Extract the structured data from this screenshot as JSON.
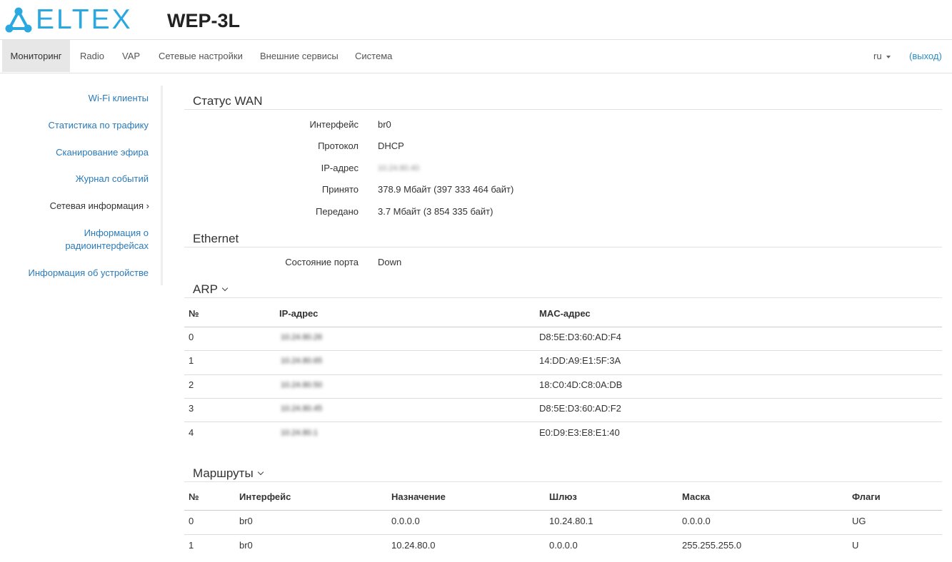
{
  "brand": {
    "logo_text": "ELTEX",
    "model": "WEP-3L",
    "accent_color": "#29a9e0"
  },
  "nav": {
    "items": [
      "Мониторинг",
      "Radio",
      "VAP",
      "Сетевые настройки",
      "Внешние сервисы",
      "Система"
    ],
    "active": "Мониторинг",
    "language": "ru",
    "logout": "(выход)"
  },
  "sidebar": {
    "items": [
      "Wi-Fi клиенты",
      "Статистика по трафику",
      "Сканирование эфира",
      "Журнал событий",
      "Сетевая информация ›",
      "Информация о",
      "радиоинтерфейсах",
      "Информация об устройстве"
    ],
    "current": "Сетевая информация ›"
  },
  "wan": {
    "title": "Статус WAN",
    "rows": [
      {
        "label": "Интерфейс",
        "value": "br0"
      },
      {
        "label": "Протокол",
        "value": "DHCP"
      },
      {
        "label": "IP-адрес",
        "value": "10.24.80.40"
      },
      {
        "label": "Принято",
        "value": "378.9 Мбайт (397 333 464 байт)"
      },
      {
        "label": "Передано",
        "value": "3.7 Мбайт (3 854 335 байт)"
      }
    ]
  },
  "ethernet": {
    "title": "Ethernet",
    "rows": [
      {
        "label": "Состояние порта",
        "value": "Down"
      }
    ]
  },
  "arp": {
    "title": "ARP",
    "headers": [
      "№",
      "IP-адрес",
      "MAC-адрес"
    ],
    "rows": [
      [
        "0",
        "10.24.80.26",
        "D8:5E:D3:60:AD:F4"
      ],
      [
        "1",
        "10.24.80.65",
        "14:DD:A9:E1:5F:3A"
      ],
      [
        "2",
        "10.24.80.50",
        "18:C0:4D:C8:0A:DB"
      ],
      [
        "3",
        "10.24.80.45",
        "D8:5E:D3:60:AD:F2"
      ],
      [
        "4",
        "10.24.80.1",
        "E0:D9:E3:E8:E1:40"
      ]
    ]
  },
  "routes": {
    "title": "Маршруты",
    "headers": [
      "№",
      "Интерфейс",
      "Назначение",
      "Шлюз",
      "Маска",
      "Флаги"
    ],
    "rows": [
      [
        "0",
        "br0",
        "0.0.0.0",
        "10.24.80.1",
        "0.0.0.0",
        "UG"
      ],
      [
        "1",
        "br0",
        "10.24.80.0",
        "0.0.0.0",
        "255.255.255.0",
        "U"
      ]
    ]
  }
}
